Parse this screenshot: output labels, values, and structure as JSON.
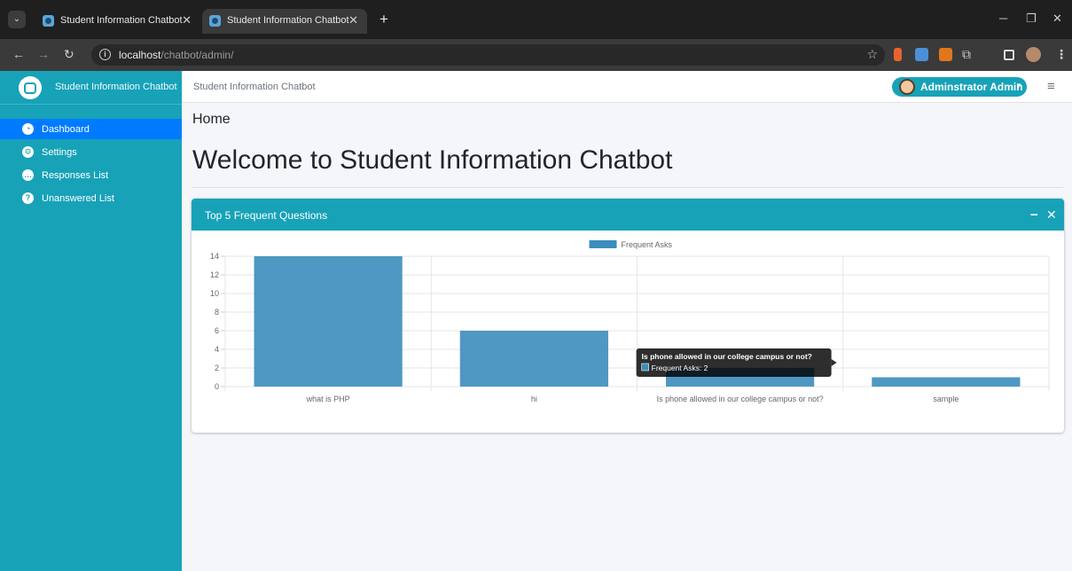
{
  "browser": {
    "tabs": [
      {
        "title": "Student Information Chatbot"
      },
      {
        "title": "Student Information Chatbot"
      }
    ],
    "url_host": "localhost",
    "url_path": "/chatbot/admin/"
  },
  "sidebar": {
    "brand": "Student Information Chatbot",
    "items": [
      {
        "label": "Dashboard",
        "icon": "tachometer-icon",
        "active": true
      },
      {
        "label": "Settings",
        "icon": "cogs-icon",
        "active": false
      },
      {
        "label": "Responses List",
        "icon": "comment-icon",
        "active": false
      },
      {
        "label": "Unanswered List",
        "icon": "question-circle-icon",
        "active": false
      }
    ]
  },
  "topnav": {
    "title": "Student Information Chatbot",
    "user": "Adminstrator Admin"
  },
  "page": {
    "breadcrumb": "Home",
    "heading": "Welcome to Student Information Chatbot"
  },
  "card": {
    "title": "Top 5 Frequent Questions",
    "accent": "#17a2b8"
  },
  "chart_data": {
    "type": "bar",
    "categories": [
      "what is PHP",
      "hi",
      "Is phone allowed in our college campus or not?",
      "sample"
    ],
    "series": [
      {
        "name": "Frequent Asks",
        "values": [
          14,
          6,
          2,
          1
        ],
        "color": "#3c8dbc"
      }
    ],
    "ylim": [
      0,
      14
    ],
    "yticks": [
      0,
      2,
      4,
      6,
      8,
      10,
      12,
      14
    ],
    "legend": "top",
    "grid": true,
    "tooltip": {
      "title": "Is phone allowed in our college campus or not?",
      "text": "Frequent Asks: 2"
    }
  }
}
